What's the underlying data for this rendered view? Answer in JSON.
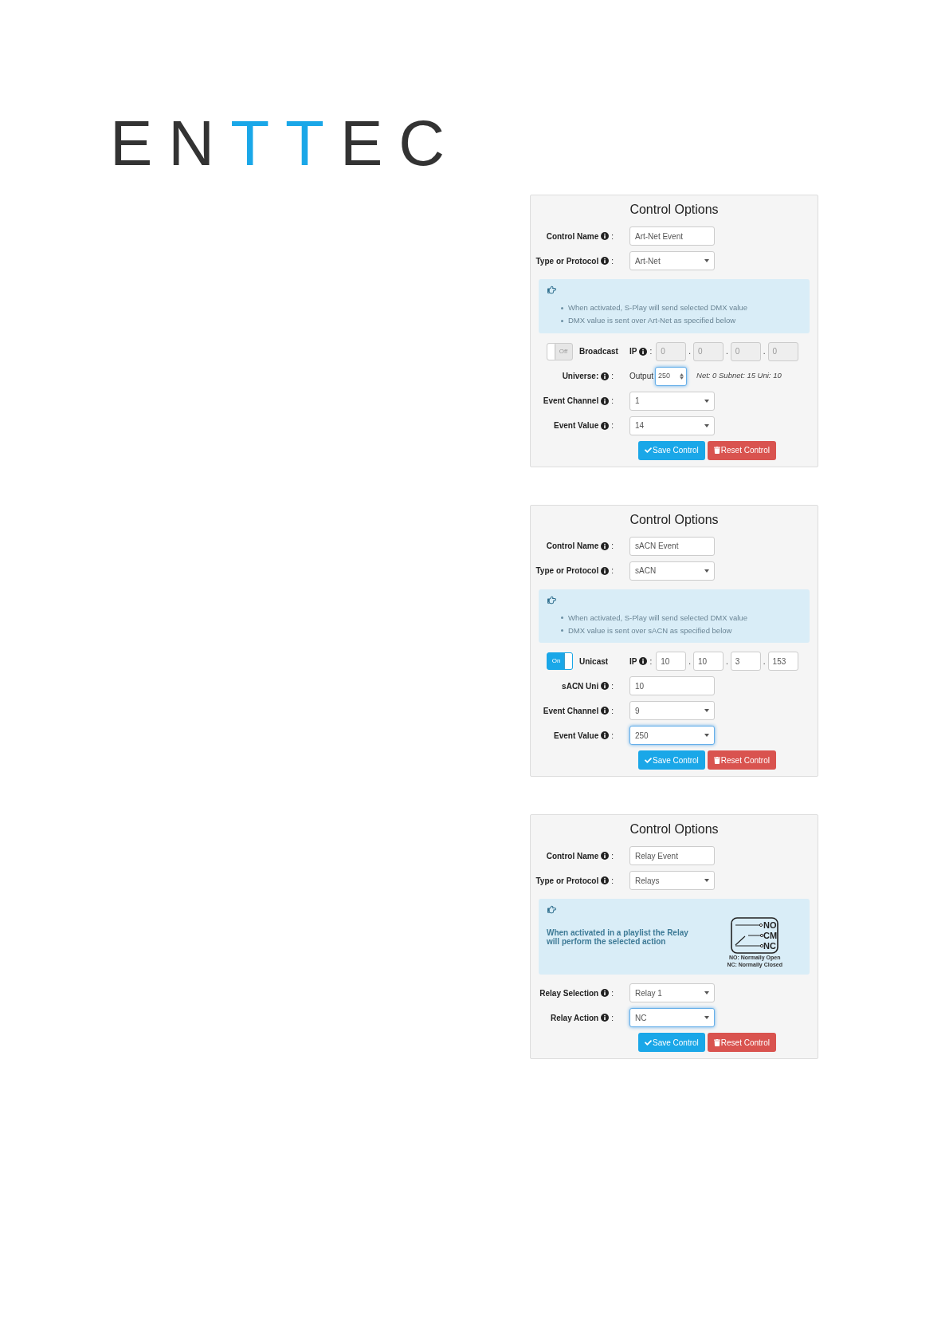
{
  "logo": {
    "letters": [
      {
        "char": "E",
        "color": "#333333"
      },
      {
        "char": "N",
        "color": "#333333"
      },
      {
        "char": "T",
        "color": "#1aa7e8"
      },
      {
        "char": "T",
        "color": "#1aa7e8"
      },
      {
        "char": "E",
        "color": "#333333"
      },
      {
        "char": "C",
        "color": "#333333"
      }
    ]
  },
  "panels": [
    {
      "title": "Control Options",
      "rows": [
        {
          "kind": "text",
          "label": "Control Name",
          "colon": ":",
          "value": "Art-Net Event",
          "focused": false
        },
        {
          "kind": "select",
          "label": "Type or Protocol",
          "colon": ":",
          "value": "Art-Net",
          "focused": false
        },
        {
          "kind": "note",
          "bullets": [
            "When activated, S-Play will send selected DMX value",
            "DMX value is sent over Art-Net as specified below"
          ]
        },
        {
          "kind": "ip",
          "toggle": {
            "label": "Off",
            "on": false
          },
          "mode": "Broadcast",
          "label": "IP",
          "colon": ":",
          "disabled": true,
          "octets": [
            "0",
            "0",
            "0",
            "0"
          ],
          "separators": [
            ".",
            ".",
            "."
          ]
        },
        {
          "kind": "universe",
          "label": "Universe:",
          "colon": ":",
          "prefix": "Output",
          "value": "250",
          "focused": true,
          "info": "Net: 0 Subnet: 15 Uni: 10"
        },
        {
          "kind": "select",
          "label": "Event Channel",
          "colon": ":",
          "value": "1",
          "focused": false
        },
        {
          "kind": "select",
          "label": "Event Value",
          "colon": ":",
          "value": "14",
          "focused": false
        }
      ],
      "buttons": [
        {
          "kind": "save",
          "label": "Save Control"
        },
        {
          "kind": "reset",
          "label": "Reset Control"
        }
      ]
    },
    {
      "title": "Control Options",
      "rows": [
        {
          "kind": "text",
          "label": "Control Name",
          "colon": ":",
          "value": "sACN Event",
          "focused": false
        },
        {
          "kind": "select",
          "label": "Type or Protocol",
          "colon": ":",
          "value": "sACN",
          "focused": false
        },
        {
          "kind": "note",
          "bullets": [
            "When activated, S-Play will send selected DMX value",
            "DMX value is sent over sACN as specified below"
          ]
        },
        {
          "kind": "ip",
          "toggle": {
            "label": "On",
            "on": true
          },
          "mode": "Unicast",
          "label": "IP",
          "colon": ":",
          "disabled": false,
          "octets": [
            "10",
            "10",
            "3",
            "153"
          ],
          "separators": [
            ".",
            ".",
            "."
          ]
        },
        {
          "kind": "text",
          "label": "sACN Uni",
          "colon": ":",
          "value": "10",
          "focused": false
        },
        {
          "kind": "select",
          "label": "Event Channel",
          "colon": ":",
          "value": "9",
          "focused": false
        },
        {
          "kind": "select",
          "label": "Event Value",
          "colon": ":",
          "value": "250",
          "focused": true
        }
      ],
      "buttons": [
        {
          "kind": "save",
          "label": "Save Control"
        },
        {
          "kind": "reset",
          "label": "Reset Control"
        }
      ]
    },
    {
      "title": "Control Options",
      "rows": [
        {
          "kind": "text",
          "label": "Control Name",
          "colon": ":",
          "value": "Relay Event",
          "focused": false
        },
        {
          "kind": "select",
          "label": "Type or Protocol",
          "colon": ":",
          "value": "Relays",
          "focused": false
        },
        {
          "kind": "relay_note",
          "text": "When activated in a playlist the Relay will perform the selected action",
          "terminals": [
            "NO",
            "CM",
            "NC"
          ],
          "legend": [
            "NO: Normally Open",
            "NC: Normally Closed"
          ]
        },
        {
          "kind": "select",
          "label": "Relay Selection",
          "colon": ":",
          "value": "Relay 1",
          "focused": false
        },
        {
          "kind": "select",
          "label": "Relay Action",
          "colon": ":",
          "value": "NC",
          "focused": true
        }
      ],
      "buttons": [
        {
          "kind": "save",
          "label": "Save Control"
        },
        {
          "kind": "reset",
          "label": "Reset Control"
        }
      ]
    }
  ]
}
